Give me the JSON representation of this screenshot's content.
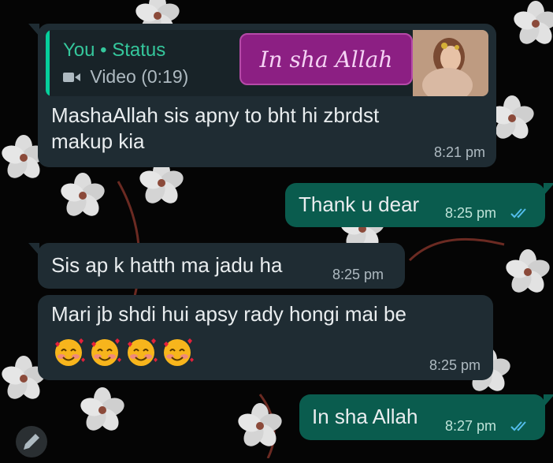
{
  "messages": [
    {
      "direction": "incoming",
      "quote": {
        "sender": "You • Status",
        "media_icon": "video-camera-icon",
        "media_label": "Video (0:19)",
        "sticker_text": "In sha Allah"
      },
      "text_lines": [
        "MashaAllah sis apny to bht hi zbrdst",
        "makup kia"
      ],
      "time": "8:21 pm"
    },
    {
      "direction": "outgoing",
      "text": "Thank u dear",
      "time": "8:25 pm",
      "status_icon": "double-check-icon"
    },
    {
      "direction": "incoming",
      "text": "Sis ap k hatth ma jadu ha",
      "time": "8:25 pm"
    },
    {
      "direction": "incoming",
      "text": "Mari jb shdi hui apsy rady hongi mai be",
      "emojis": [
        "smiling-face-with-hearts-icon",
        "smiling-face-with-hearts-icon",
        "smiling-face-with-hearts-icon",
        "smiling-face-with-hearts-icon"
      ],
      "time": "8:25 pm"
    },
    {
      "direction": "outgoing",
      "text": "In sha Allah",
      "time": "8:27 pm",
      "status_icon": "double-check-icon"
    }
  ],
  "colors": {
    "incoming_bubble": "#1f2c33",
    "outgoing_bubble": "#0a5c4e",
    "quote_accent": "#06cf9c",
    "read_ticks": "#53bdeb",
    "sticker": "#8c1f83"
  }
}
